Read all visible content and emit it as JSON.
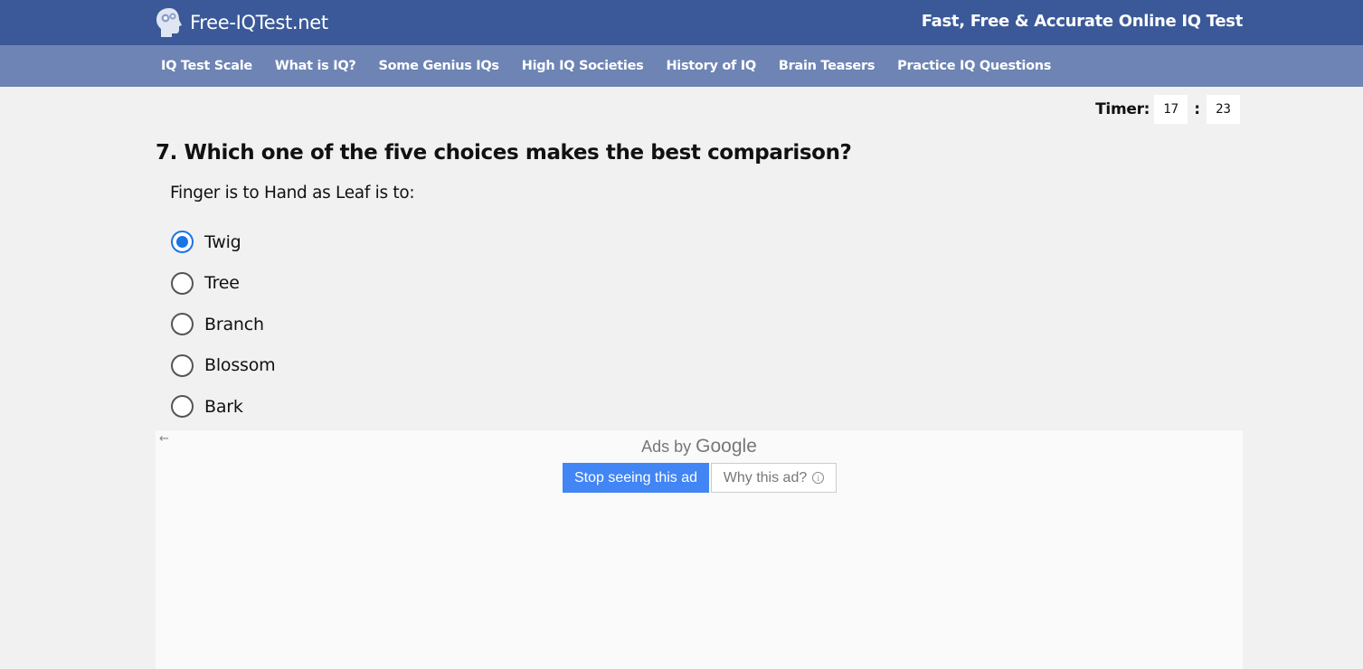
{
  "header": {
    "site_name": "Free-IQTest.net",
    "tagline": "Fast, Free & Accurate Online IQ Test",
    "logo_icon": "brain-head-icon"
  },
  "nav": {
    "items": [
      {
        "label": "IQ Test Scale"
      },
      {
        "label": "What is IQ?"
      },
      {
        "label": "Some Genius IQs"
      },
      {
        "label": "High IQ Societies"
      },
      {
        "label": "History of IQ"
      },
      {
        "label": "Brain Teasers"
      },
      {
        "label": "Practice IQ Questions"
      }
    ]
  },
  "timer": {
    "label": "Timer:",
    "minutes": "17",
    "separator": ":",
    "seconds": "23"
  },
  "question": {
    "title": "7. Which one of the five choices makes the best comparison?",
    "prompt": "Finger is to Hand as Leaf is to:",
    "options": [
      {
        "label": "Twig",
        "selected": true
      },
      {
        "label": "Tree",
        "selected": false
      },
      {
        "label": "Branch",
        "selected": false
      },
      {
        "label": "Blossom",
        "selected": false
      },
      {
        "label": "Bark",
        "selected": false
      }
    ]
  },
  "ad": {
    "back_arrow": "←",
    "ads_by": "Ads by",
    "google": "Google",
    "stop_label": "Stop seeing this ad",
    "why_label": "Why this ad?",
    "info_glyph": "i"
  },
  "colors": {
    "topbar": "#3b5998",
    "navbar": "#6d84b4",
    "radio_selected": "#1a73e8",
    "ad_button": "#4285f4"
  }
}
